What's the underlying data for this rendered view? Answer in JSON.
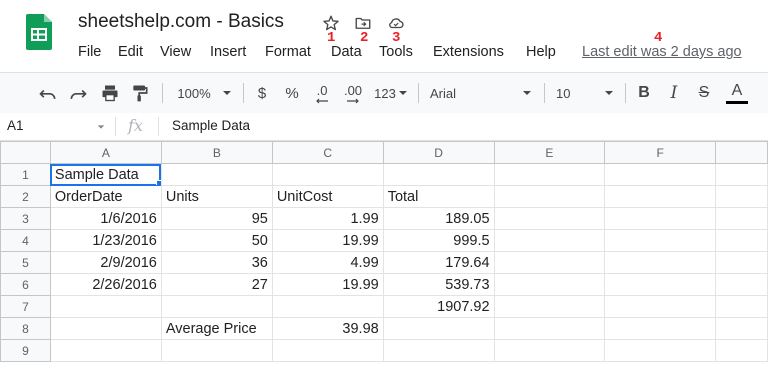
{
  "app": {
    "title": "sheetshelp.com - Basics",
    "last_edit": "Last edit was 2 days ago",
    "brand_color": "#0f9d58"
  },
  "menu": [
    "File",
    "Edit",
    "View",
    "Insert",
    "Format",
    "Data",
    "Tools",
    "Extensions",
    "Help"
  ],
  "annotations": {
    "a1": "1",
    "a2": "2",
    "a3": "3",
    "a4": "4"
  },
  "icons": {
    "star": "star-icon",
    "move": "move-to-folder-icon",
    "cloud": "cloud-saved-icon"
  },
  "toolbar": {
    "zoom": "100%",
    "currency": "$",
    "percent": "%",
    "decimal_decrease": ".0",
    "decimal_increase": ".00",
    "more_formats": "123",
    "font": "Arial",
    "font_size": "10",
    "bold": "B",
    "italic": "I",
    "strike": "S",
    "text_color": "A"
  },
  "formula_bar": {
    "name_box": "A1",
    "fx": "fx",
    "content": "Sample Data"
  },
  "sheet": {
    "columns": [
      "A",
      "B",
      "C",
      "D",
      "E",
      "F"
    ],
    "rows": [
      {
        "n": "1",
        "cells": [
          "Sample Data",
          "",
          "",
          "",
          "",
          ""
        ]
      },
      {
        "n": "2",
        "cells": [
          "OrderDate",
          "Units",
          "UnitCost",
          "Total",
          "",
          ""
        ]
      },
      {
        "n": "3",
        "cells": [
          "1/6/2016",
          "95",
          "1.99",
          "189.05",
          "",
          ""
        ]
      },
      {
        "n": "4",
        "cells": [
          "1/23/2016",
          "50",
          "19.99",
          "999.5",
          "",
          ""
        ]
      },
      {
        "n": "5",
        "cells": [
          "2/9/2016",
          "36",
          "4.99",
          "179.64",
          "",
          ""
        ]
      },
      {
        "n": "6",
        "cells": [
          "2/26/2016",
          "27",
          "19.99",
          "539.73",
          "",
          ""
        ]
      },
      {
        "n": "7",
        "cells": [
          "",
          "",
          "",
          "1907.92",
          "",
          ""
        ]
      },
      {
        "n": "8",
        "cells": [
          "",
          "Average Price",
          "39.98",
          "",
          "",
          ""
        ]
      },
      {
        "n": "9",
        "cells": [
          "",
          "",
          "",
          "",
          "",
          ""
        ]
      }
    ]
  }
}
